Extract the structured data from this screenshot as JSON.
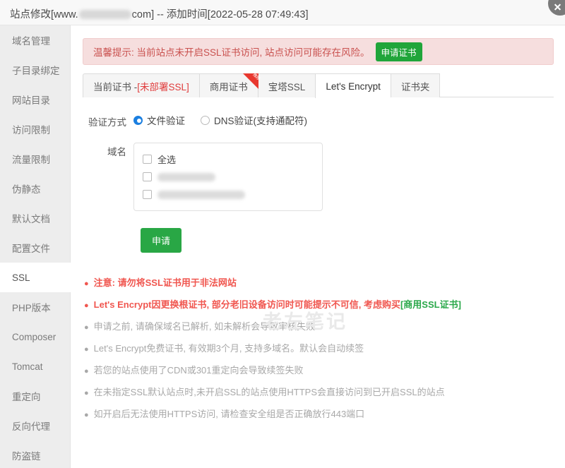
{
  "titlebar": {
    "prefix": "站点修改[www.",
    "suffix": "com] -- 添加时间[2022-05-28 07:49:43]",
    "close_icon": "close-icon"
  },
  "sidebar": {
    "items": [
      {
        "label": "域名管理",
        "active": false
      },
      {
        "label": "子目录绑定",
        "active": false
      },
      {
        "label": "网站目录",
        "active": false
      },
      {
        "label": "访问限制",
        "active": false
      },
      {
        "label": "流量限制",
        "active": false
      },
      {
        "label": "伪静态",
        "active": false
      },
      {
        "label": "默认文档",
        "active": false
      },
      {
        "label": "配置文件",
        "active": false
      },
      {
        "label": "SSL",
        "active": true
      },
      {
        "label": "PHP版本",
        "active": false
      },
      {
        "label": "Composer",
        "active": false
      },
      {
        "label": "Tomcat",
        "active": false
      },
      {
        "label": "重定向",
        "active": false
      },
      {
        "label": "反向代理",
        "active": false
      },
      {
        "label": "防盗链",
        "active": false
      }
    ]
  },
  "alert": {
    "text": "温馨提示: 当前站点未开启SSL证书访问, 站点访问可能存在风险。",
    "button_label": "申请证书",
    "bg_color": "#f6dede",
    "text_color": "#c9514f",
    "button_color": "#20a53a"
  },
  "tabs": {
    "items": [
      {
        "label": "当前证书 - ",
        "warn": "[未部署SSL]",
        "active": false,
        "ribbon": ""
      },
      {
        "label": "商用证书",
        "warn": "",
        "active": false,
        "ribbon": "推荐"
      },
      {
        "label": "宝塔SSL",
        "warn": "",
        "active": false,
        "ribbon": ""
      },
      {
        "label": "Let's Encrypt",
        "warn": "",
        "active": true,
        "ribbon": ""
      },
      {
        "label": "证书夹",
        "warn": "",
        "active": false,
        "ribbon": ""
      }
    ]
  },
  "form": {
    "verify_label": "验证方式",
    "verify_options": [
      {
        "label": "文件验证",
        "selected": true
      },
      {
        "label": "DNS验证(支持通配符)",
        "selected": false
      }
    ],
    "domain_label": "域名",
    "domain_rows": [
      {
        "label": "全选",
        "redacted": false,
        "checked": false
      },
      {
        "label": "",
        "redacted": true,
        "checked": false
      },
      {
        "label": "",
        "redacted": true,
        "checked": false
      }
    ],
    "apply_label": "申请",
    "apply_color": "#29a745"
  },
  "watermark": {
    "text": "老左笔记"
  },
  "notes": [
    {
      "text": "注意: 请勿将SSL证书用于非法网站",
      "style": "danger",
      "link": ""
    },
    {
      "text": "Let's Encrypt因更换根证书, 部分老旧设备访问时可能提示不可信, 考虑购买",
      "style": "danger",
      "link": "[商用SSL证书]"
    },
    {
      "text": "申请之前, 请确保域名已解析, 如未解析会导致审核失败",
      "style": "muted",
      "link": ""
    },
    {
      "text": "Let's Encrypt免费证书, 有效期3个月, 支持多域名。默认会自动续签",
      "style": "muted",
      "link": ""
    },
    {
      "text": "若您的站点使用了CDN或301重定向会导致续签失败",
      "style": "muted",
      "link": ""
    },
    {
      "text": "在未指定SSL默认站点时,未开启SSL的站点使用HTTPS会直接访问到已开启SSL的站点",
      "style": "muted",
      "link": ""
    },
    {
      "text": "如开启后无法使用HTTPS访问, 请检查安全组是否正确放行443端口",
      "style": "muted",
      "link": ""
    }
  ]
}
